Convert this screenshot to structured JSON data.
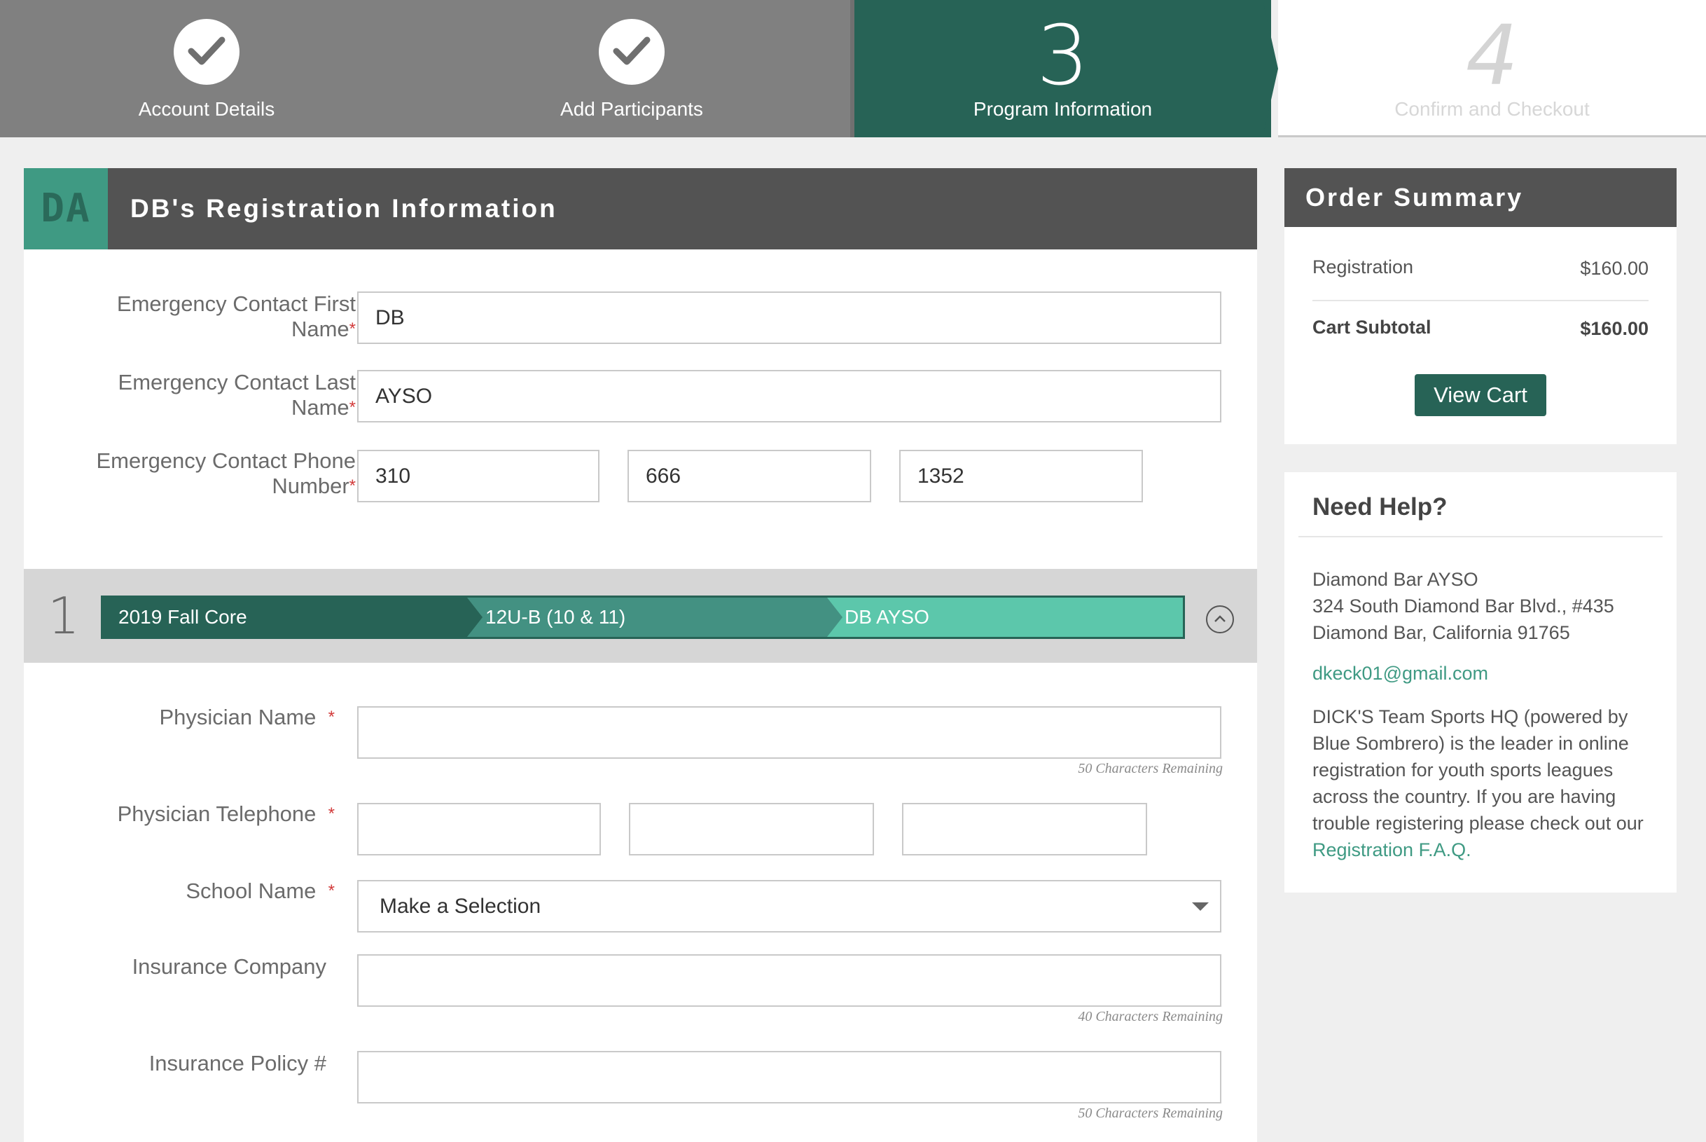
{
  "steps": [
    {
      "label": "Account Details",
      "state": "done"
    },
    {
      "label": "Add Participants",
      "state": "done"
    },
    {
      "number": "3",
      "label": "Program Information",
      "state": "current"
    },
    {
      "number": "4",
      "label": "Confirm and Checkout",
      "state": "upcoming"
    }
  ],
  "main": {
    "badge": "DA",
    "title": "DB's Registration Information",
    "emergency": {
      "first_name_label": "Emergency Contact First Name",
      "first_name_value": "DB",
      "last_name_label": "Emergency Contact Last Name",
      "last_name_value": "AYSO",
      "phone_label": "Emergency Contact Phone Number",
      "phone_area": "310",
      "phone_prefix": "666",
      "phone_line": "1352"
    },
    "program": {
      "number": "1",
      "crumbs": [
        "2019 Fall Core",
        "12U-B (10 & 11)",
        "DB AYSO"
      ]
    },
    "fields": {
      "physician_name_label": "Physician Name",
      "physician_name_remaining": "50 Characters Remaining",
      "physician_phone_label": "Physician Telephone",
      "school_label": "School Name",
      "school_value": "Make a Selection",
      "insurance_company_label": "Insurance Company",
      "insurance_company_remaining": "40 Characters Remaining",
      "insurance_policy_label": "Insurance Policy #",
      "insurance_policy_remaining": "50 Characters Remaining"
    }
  },
  "order_summary": {
    "title": "Order Summary",
    "registration_label": "Registration",
    "registration_amount": "$160.00",
    "subtotal_label": "Cart Subtotal",
    "subtotal_amount": "$160.00",
    "view_cart_label": "View Cart"
  },
  "help": {
    "title": "Need Help?",
    "org_name": "Diamond Bar AYSO",
    "address_line1": "324 South Diamond Bar Blvd., #435",
    "address_line2": "Diamond Bar, California 91765",
    "email": "dkeck01@gmail.com",
    "text": "DICK'S Team Sports HQ (powered by Blue Sombrero) is the leader in online registration for youth sports leagues across the country. If you are having trouble registering please check out our",
    "faq_link": "Registration F.A.Q."
  },
  "colors": {
    "brand_green": "#276356",
    "mid_green": "#439182",
    "light_green": "#5cc7ab",
    "header_gray": "#535353",
    "done_gray": "#808080"
  }
}
